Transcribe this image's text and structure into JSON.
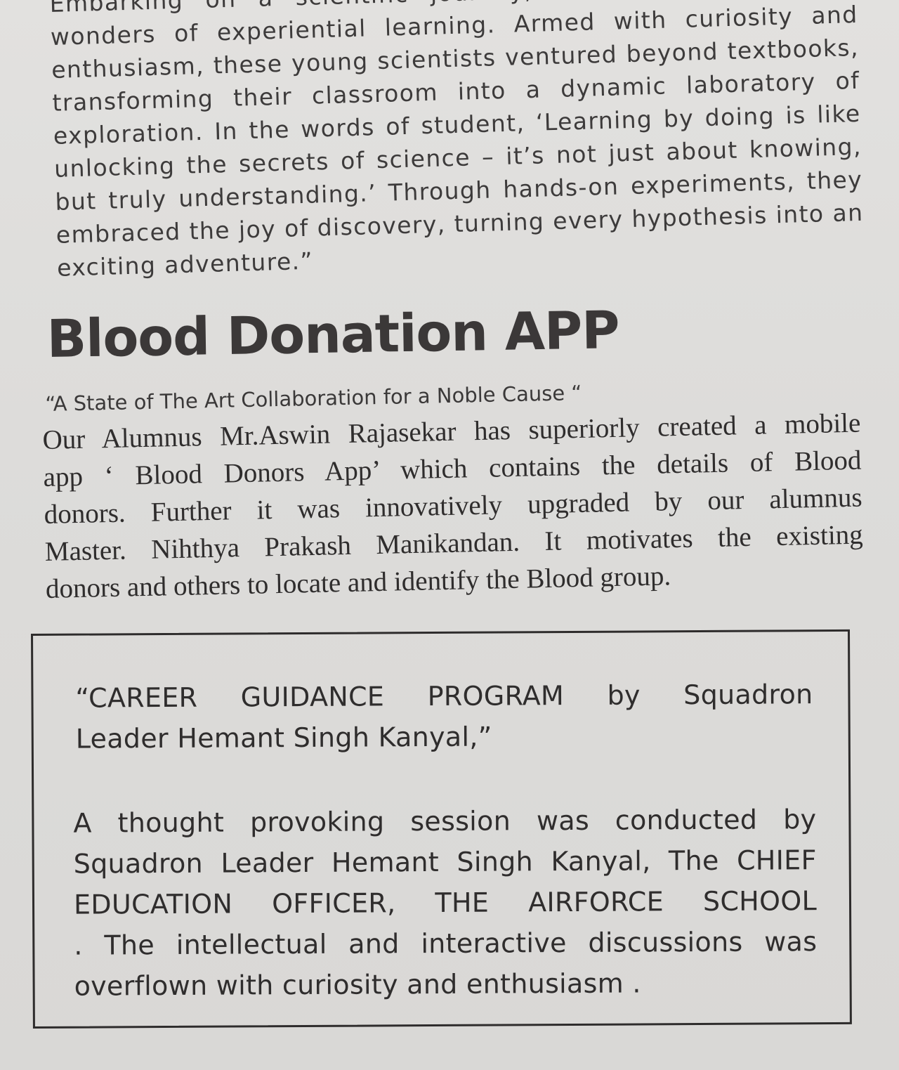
{
  "top_article": {
    "lines": [
      "Embarking on a scientific journey, students explored the",
      "wonders of experiential learning. Armed with curiosity and",
      "enthusiasm, these young scientists ventured beyond textbooks,",
      "transforming their classroom into a dynamic laboratory of",
      "exploration. In the words of student, ‘Learning by doing is like",
      "unlocking the secrets of science – it’s not just about knowing,",
      "but truly understanding.’ Through hands-on experiments, they",
      "embraced the joy of discovery, turning every hypothesis into an",
      "exciting adventure.”"
    ]
  },
  "blood_donation": {
    "heading": "Blood Donation APP",
    "subtitle": "“A State of The Art Collaboration for a Noble Cause “",
    "body_lines": [
      "Our Alumnus Mr.Aswin Rajasekar has superiorly created a mobile",
      "app ‘ Blood Donors App’ which contains the details of Blood",
      "donors. Further it was innovatively upgraded by our alumnus",
      "Master. Nihthya Prakash Manikandan. It motivates the existing",
      "donors and others to locate and identify the Blood group."
    ]
  },
  "career_box": {
    "title_lines": [
      "“CAREER GUIDANCE PROGRAM by Squadron",
      "Leader Hemant Singh Kanyal,”"
    ],
    "body_lines": [
      "A thought provoking session was conducted by",
      "Squadron Leader Hemant Singh Kanyal, The CHIEF",
      "EDUCATION OFFICER, THE AIRFORCE SCHOOL",
      ". The intellectual and interactive discussions was",
      "overflown with curiosity and enthusiasm ."
    ]
  }
}
